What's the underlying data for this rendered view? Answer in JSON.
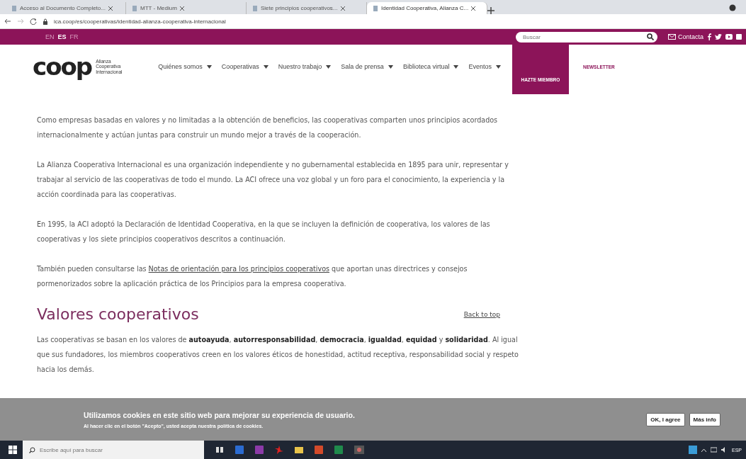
{
  "browser": {
    "tabs": [
      {
        "title": "Acceso al Documento Completo...",
        "selected": false
      },
      {
        "title": "MTT - Medium",
        "selected": false
      },
      {
        "title": "Siete principios cooperativos...",
        "selected": false
      },
      {
        "title": "Identidad Cooperativa, Alianza C...",
        "selected": true
      }
    ],
    "url": "ica.coop/es/cooperativas/identidad-alianza-cooperativa-internacional"
  },
  "topbar": {
    "languages": [
      {
        "label": "EN",
        "selected": false
      },
      {
        "label": "ES",
        "selected": true
      },
      {
        "label": "FR",
        "selected": false
      }
    ],
    "search": {
      "placeholder": "Buscar"
    },
    "contact": "Contacta"
  },
  "header": {
    "logo": "coop",
    "logo_caption": "Alianza Cooperativa Internacional",
    "nav": [
      "Quiénes somos",
      "Cooperativas",
      "Nuestro trabajo",
      "Sala de prensa",
      "Biblioteca virtual",
      "Eventos"
    ],
    "member_button": "HAZTE MIEMBRO",
    "newsletter": "NEWSLETTER"
  },
  "content": {
    "paragraphs": [
      "Como empresas basadas en valores y no limitadas a la obtención de beneficios, las cooperativas comparten unos principios acordados internacionalmente y actúan juntas para construir un mundo mejor a través de la cooperación.",
      "La Alianza Cooperativa Internacional es una organización independiente y no gubernamental establecida en 1895 para unir, representar y trabajar al servicio de las cooperativas de todo el mundo. La ACI ofrece una voz global y un foro para el conocimiento, la experiencia y la acción coordinada para las cooperativas.",
      "En 1995, la ACI adoptó la Declaración de Identidad Cooperativa, en la que se incluyen la definición de cooperativa, los valores de las cooperativas y los siete principios cooperativos descritos a continuación."
    ],
    "link_paragraph": {
      "before": "También pueden consultarse las",
      "link": "Notas de orientación para los principios cooperativos",
      "after": "que aportan unas directrices y consejos pormenorizados sobre la aplicación práctica de los Principios para la empresa cooperativa."
    },
    "heading": "Valores cooperativos",
    "back_to_top": "Back to top",
    "values_paragraph": "Las cooperativas se basan en los valores de **autoayuda**, **autorresponsabilidad**, **democracia**, **igualdad**, **equidad** y **solidaridad**. Al igual que sus fundadores, los miembros cooperativos creen en los valores éticos de honestidad, actitud receptiva, responsabilidad social y respeto hacia los demás."
  },
  "cookie_banner": {
    "message": "Utilizamos cookies en este sitio web para mejorar su experiencia de usuario.",
    "detail": "Al hacer clic en el botón \"Acepto\", usted acepta nuestra política de cookies.",
    "buttons": [
      "OK, I agree",
      "Más info"
    ]
  },
  "taskbar": {
    "search": {
      "placeholder": "Escribe aquí para buscar"
    },
    "language": "ESP"
  }
}
